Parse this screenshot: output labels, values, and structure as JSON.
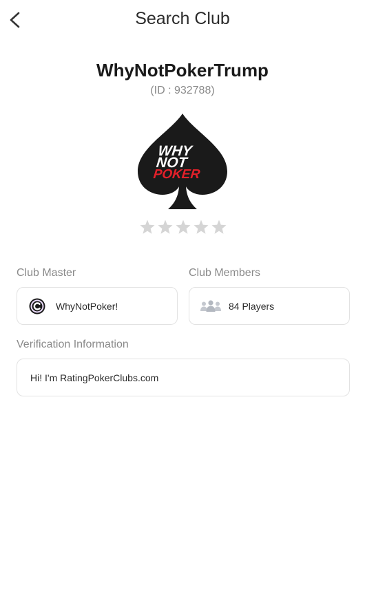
{
  "header": {
    "title": "Search Club",
    "back_icon": "chevron-left-icon"
  },
  "club": {
    "name": "WhyNotPokerTrump",
    "id_text": "(ID : 932788)",
    "logo": {
      "line1": "WHY",
      "line2": "NOT",
      "line3": "POKER",
      "accent_color": "#e3202a",
      "shape": "spade"
    },
    "rating": {
      "value": 0,
      "max": 5,
      "star_color": "#d5d5d5"
    }
  },
  "club_master": {
    "label": "Club Master",
    "name": "WhyNotPoker!",
    "avatar_icon": "letter-c-avatar-icon"
  },
  "club_members": {
    "label": "Club Members",
    "count_text": "84 Players",
    "icon": "people-icon"
  },
  "verification": {
    "label": "Verification Information",
    "text": "Hi! I'm RatingPokerClubs.com"
  }
}
